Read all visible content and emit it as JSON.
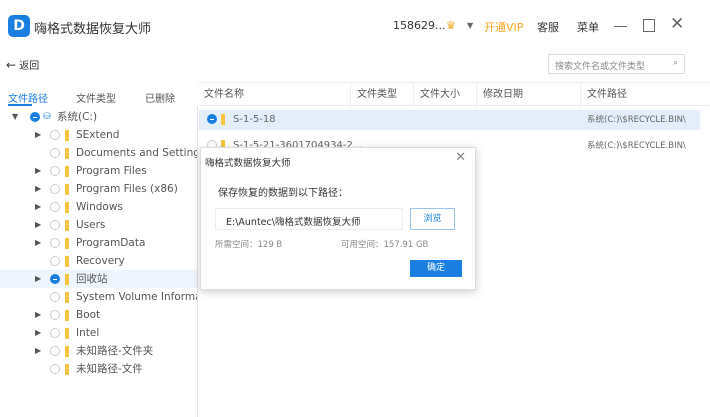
{
  "app": {
    "title": "嗨格式数据恢复大师",
    "logo": "D",
    "user": "158629...",
    "vip": "开通VIP",
    "service": "客服",
    "menu": "菜单"
  },
  "toolbar": {
    "back": "返回",
    "search_placeholder": "搜索文件名或文件类型"
  },
  "tabs": [
    "文件路径",
    "文件类型",
    "已删除"
  ],
  "columns": [
    "文件名称",
    "文件类型",
    "文件大小",
    "修改日期",
    "文件路径"
  ],
  "tree": [
    {
      "label": "系统(C:)",
      "level": 0,
      "arrow": "▼",
      "checked": true
    },
    {
      "label": "SExtend",
      "level": 1,
      "arrow": "▶"
    },
    {
      "label": "Documents and Settings",
      "level": 1,
      "arrow": ""
    },
    {
      "label": "Program Files",
      "level": 1,
      "arrow": "▶"
    },
    {
      "label": "Program Files (x86)",
      "level": 1,
      "arrow": "▶"
    },
    {
      "label": "Windows",
      "level": 1,
      "arrow": "▶"
    },
    {
      "label": "Users",
      "level": 1,
      "arrow": "▶"
    },
    {
      "label": "ProgramData",
      "level": 1,
      "arrow": "▶"
    },
    {
      "label": "Recovery",
      "level": 1,
      "arrow": ""
    },
    {
      "label": "回收站",
      "level": 1,
      "arrow": "▶",
      "checked": true,
      "selected": true
    },
    {
      "label": "System Volume Information",
      "level": 1,
      "arrow": ""
    },
    {
      "label": "Boot",
      "level": 1,
      "arrow": "▶"
    },
    {
      "label": "Intel",
      "level": 1,
      "arrow": "▶"
    },
    {
      "label": "未知路径-文件夹",
      "level": 1,
      "arrow": "▶"
    },
    {
      "label": "未知路径-文件",
      "level": 1,
      "arrow": ""
    }
  ],
  "files": [
    {
      "name": "S-1-5-18",
      "path": "系统(C:)\\$RECYCLE.BIN\\",
      "checked": true
    },
    {
      "name": "S-1-5-21-3601704934-2...",
      "path": "系统(C:)\\$RECYCLE.BIN\\",
      "checked": false
    }
  ],
  "dialog": {
    "title": "嗨格式数据恢复大师",
    "prompt": "保存恢复的数据到以下路径：",
    "path": "E:\\Auntec\\嗨格式数据恢复大师",
    "browse": "浏览",
    "required": "所需空间：129 B",
    "available": "可用空间：157.91 GB",
    "ok": "确定"
  },
  "colors": {
    "accent": "#1a7fe0",
    "vip": "#f5a623"
  }
}
